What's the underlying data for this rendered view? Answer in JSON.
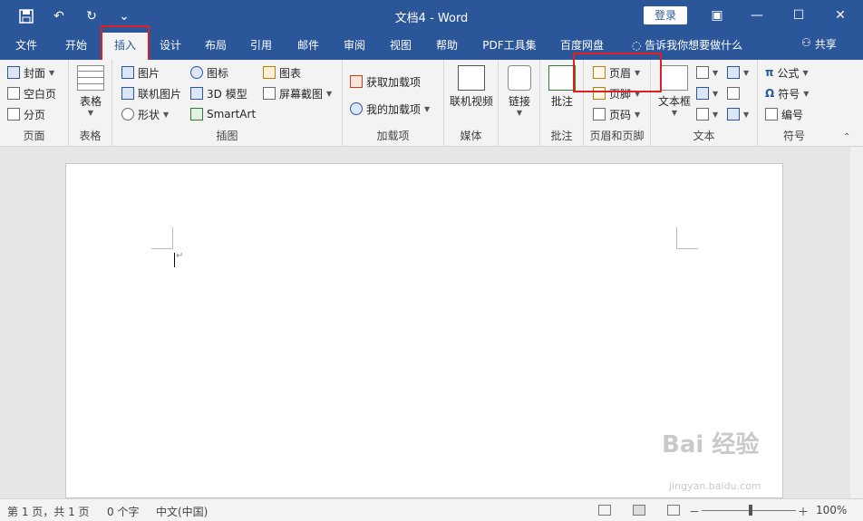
{
  "window": {
    "title": "文档4 - Word",
    "login_label": "登录",
    "qat": {
      "save_icon": "save-icon",
      "undo_icon": "undo-icon",
      "redo_icon": "redo-icon",
      "customize_icon": "customize-icon"
    },
    "controls": {
      "ribbon_options_icon": "ribbon-display-icon",
      "minimize_icon": "minimize-icon",
      "maximize_icon": "maximize-icon",
      "close_icon": "close-icon"
    }
  },
  "tabs": [
    {
      "label": "文件"
    },
    {
      "label": "开始"
    },
    {
      "label": "插入"
    },
    {
      "label": "设计"
    },
    {
      "label": "布局"
    },
    {
      "label": "引用"
    },
    {
      "label": "邮件"
    },
    {
      "label": "审阅"
    },
    {
      "label": "视图"
    },
    {
      "label": "帮助"
    },
    {
      "label": "PDF工具集"
    },
    {
      "label": "百度网盘"
    },
    {
      "label": "告诉我你想要做什么"
    }
  ],
  "active_tab": "插入",
  "share_label": "共享",
  "ribbon": {
    "pages": {
      "label": "页面",
      "items": [
        "封面",
        "空白页",
        "分页"
      ]
    },
    "tables": {
      "label": "表格",
      "button": "表格"
    },
    "illustrations": {
      "label": "插图",
      "items": [
        "图片",
        "联机图片",
        "形状",
        "图标",
        "3D 模型",
        "SmartArt",
        "图表",
        "屏幕截图"
      ]
    },
    "addins": {
      "label": "加载项",
      "items": [
        "获取加载项",
        "我的加载项"
      ]
    },
    "media": {
      "label": "媒体",
      "button": "联机视频"
    },
    "links": {
      "button": "链接"
    },
    "comments": {
      "label": "批注",
      "button": "批注"
    },
    "header_footer": {
      "label": "页眉和页脚",
      "items": [
        "页眉",
        "页脚",
        "页码"
      ]
    },
    "text": {
      "label": "文本",
      "button": "文本框"
    },
    "symbols": {
      "label": "符号",
      "items": [
        "公式",
        "符号",
        "编号"
      ]
    }
  },
  "status": {
    "page": "第 1 页，共 1 页",
    "words": "0 个字",
    "language": "中文(中国)",
    "zoom_minus": "－",
    "zoom_plus": "＋",
    "zoom": "100%"
  },
  "watermark": {
    "brand": "Bai 经验",
    "url": "jingyan.baidu.com"
  },
  "colors": {
    "accent": "#2b579a",
    "highlight": "#e02020"
  }
}
